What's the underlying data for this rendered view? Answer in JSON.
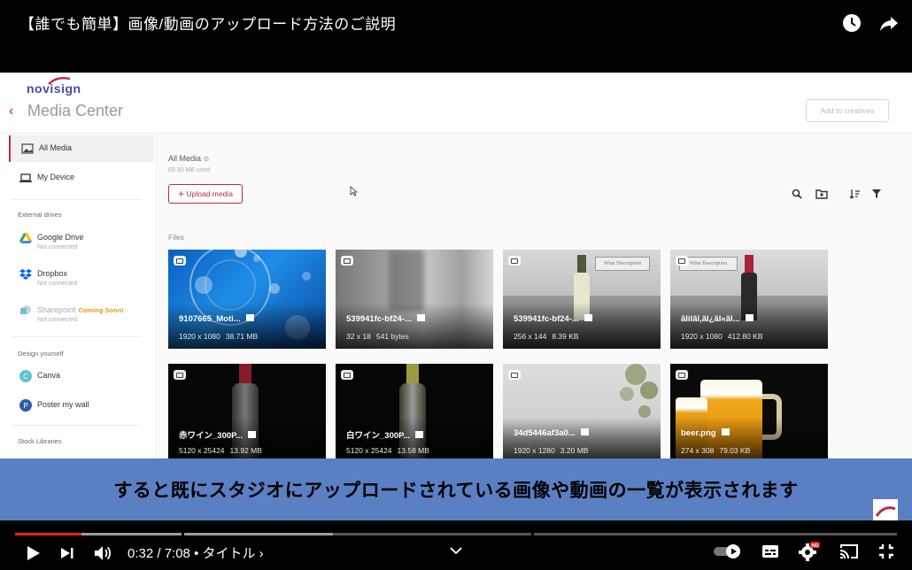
{
  "video": {
    "title": "【誰でも簡単】画像/動画のアップロード方法のご説明",
    "caption": "すると既にスタジオにアップロードされている画像や動画の一覧が表示されます",
    "time_display": "0:32 / 7:08",
    "chapter": "• タイトル ›",
    "progress_fraction": 0.075,
    "buffered_fraction": 0.36,
    "accent_color": "#e62117"
  },
  "app": {
    "logo_text": "novisign",
    "title": "Media Center",
    "add_creatives_label": "Add to creatives",
    "brand_color": "#c2283f"
  },
  "sidebar": {
    "all_media": "All Media",
    "my_device": "My Device",
    "external_header": "External drives",
    "google_drive": "Google Drive",
    "dropbox": "Dropbox",
    "sharepoint": "Sharepoint",
    "coming_soon": "Coming Soon!",
    "not_connected": "Not connected",
    "design_header": "Design yourself",
    "canva": "Canva",
    "poster": "Poster my wall",
    "stock_header": "Stock Libraries"
  },
  "main": {
    "crumb": "All Media",
    "used": "69.90 MB used",
    "upload_label": "Upload media",
    "files_label": "Files"
  },
  "files": [
    {
      "name": "9107665_Moti...",
      "dims": "1920 x 1080",
      "size": "38.71 MB",
      "kind": "video"
    },
    {
      "name": "539941fc-bf24-...",
      "dims": "32 x 18",
      "size": "541 bytes",
      "kind": "image"
    },
    {
      "name": "539941fc-bf24-...",
      "dims": "256 x 144",
      "size": "8.39 KB",
      "kind": "image"
    },
    {
      "name": "ãlilãl,ãl¿ãl«ãl...",
      "dims": "1920 x 1080",
      "size": "412.80 KB",
      "kind": "image"
    },
    {
      "name": "赤ワイン_300P...",
      "dims": "5120 x 25424",
      "size": "13.92 MB",
      "kind": "image"
    },
    {
      "name": "白ワイン_300P...",
      "dims": "5120 x 25424",
      "size": "13.58 MB",
      "kind": "image"
    },
    {
      "name": "34d5446af3a0...",
      "dims": "1920 x 1280",
      "size": "3.20 MB",
      "kind": "image"
    },
    {
      "name": "beer.png",
      "dims": "274 x 308",
      "size": "79.03 KB",
      "kind": "image"
    }
  ],
  "icons": [
    "clock-icon",
    "share-icon",
    "back-icon",
    "photo-icon",
    "laptop-icon",
    "google-drive-icon",
    "dropbox-icon",
    "sharepoint-icon",
    "canva-icon",
    "poster-icon",
    "search-icon",
    "new-folder-icon",
    "sort-icon",
    "filter-icon",
    "play-icon",
    "next-icon",
    "volume-icon",
    "chevron-down-icon",
    "autoplay-toggle-icon",
    "subtitles-icon",
    "settings-icon",
    "cast-icon",
    "exit-fullscreen-icon"
  ]
}
